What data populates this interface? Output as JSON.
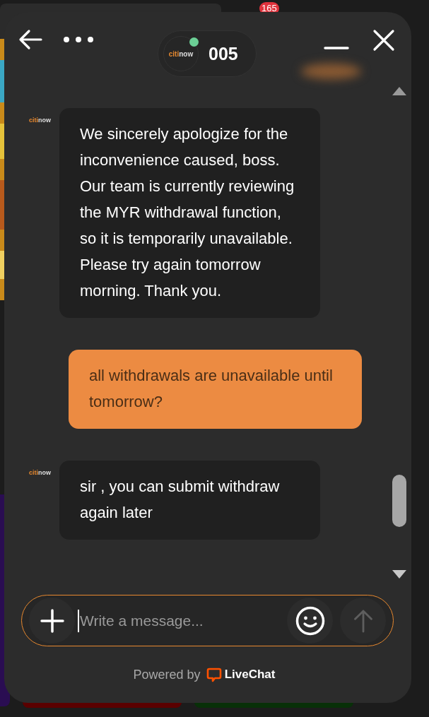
{
  "background": {
    "notification_badge": "165"
  },
  "header": {
    "logo": {
      "part_1": "citi",
      "part_2": "now"
    },
    "online": true,
    "agent_name": "005"
  },
  "messages": [
    {
      "kind": "agent",
      "logo": {
        "part_1": "citi",
        "part_2": "now"
      },
      "text": "We sincerely apologize for the inconvenience caused, boss. Our team is currently reviewing the MYR withdrawal function, so it is temporarily unavailable. Please try again tomorrow morning. Thank you."
    },
    {
      "kind": "customer",
      "text": "all withdrawals are unavailable until tomorrow?"
    },
    {
      "kind": "agent",
      "logo": {
        "part_1": "citi",
        "part_2": "now"
      },
      "text": "sir , you can submit withdraw again later"
    }
  ],
  "composer": {
    "placeholder": "Write a message..."
  },
  "footer": {
    "powered_by": "Powered by",
    "brand": "LiveChat"
  }
}
